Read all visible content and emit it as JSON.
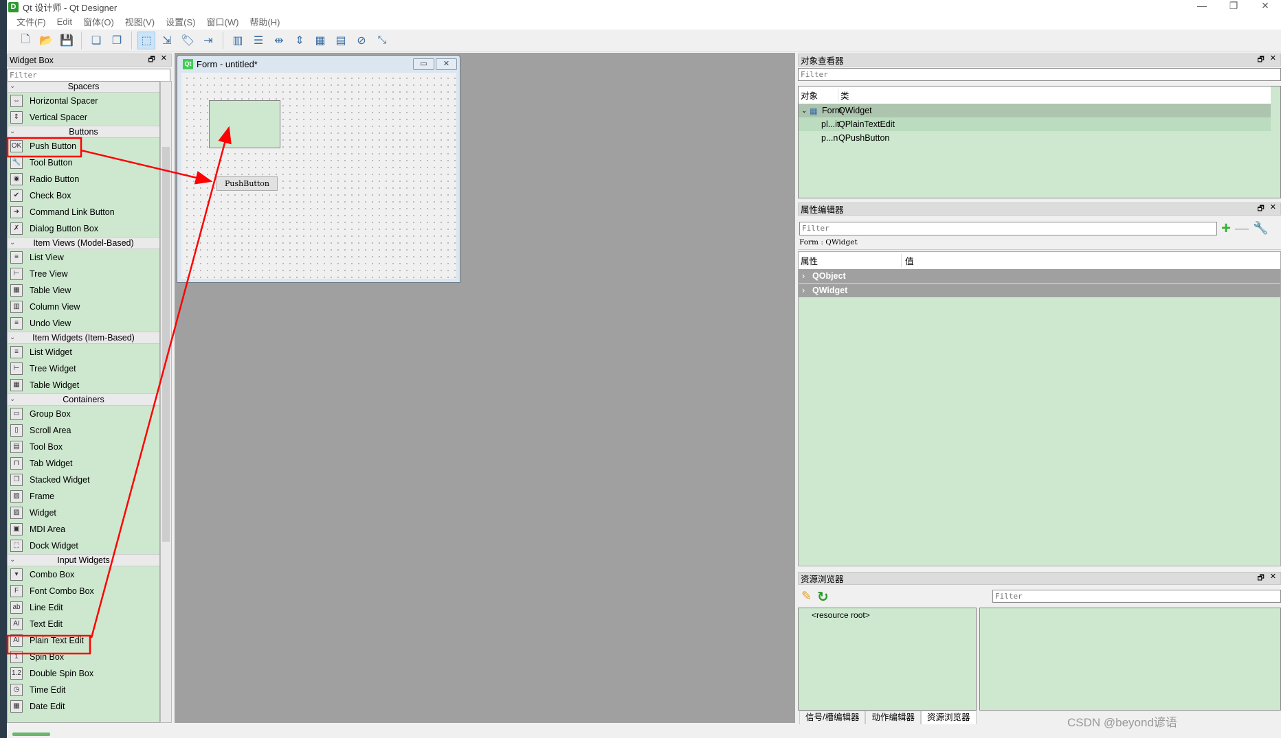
{
  "window": {
    "title": "Qt 设计师 - Qt Designer",
    "app_icon": "D",
    "controls": [
      "—",
      "❐",
      "✕"
    ]
  },
  "menu": [
    "文件(F)",
    "Edit",
    "窗体(O)",
    "视图(V)",
    "设置(S)",
    "窗口(W)",
    "帮助(H)"
  ],
  "toolbar": [
    {
      "icon": "new-file-icon",
      "glyph": "🗋"
    },
    {
      "icon": "open-folder-icon",
      "glyph": "📂"
    },
    {
      "icon": "save-icon",
      "glyph": "💾"
    },
    {
      "sep": true
    },
    {
      "icon": "send-to-back-icon",
      "glyph": "❏"
    },
    {
      "icon": "bring-to-front-icon",
      "glyph": "❐"
    },
    {
      "sep": true
    },
    {
      "icon": "edit-widgets-icon",
      "glyph": "⬚",
      "active": true
    },
    {
      "icon": "edit-signals-slots-icon",
      "glyph": "⇲"
    },
    {
      "icon": "edit-buddies-icon",
      "glyph": "🏷"
    },
    {
      "icon": "edit-tab-order-icon",
      "glyph": "⇥"
    },
    {
      "sep": true
    },
    {
      "icon": "layout-horizontal-icon",
      "glyph": "▥"
    },
    {
      "icon": "layout-vertical-icon",
      "glyph": "☰"
    },
    {
      "icon": "splitter-horizontal-icon",
      "glyph": "⇹"
    },
    {
      "icon": "splitter-vertical-icon",
      "glyph": "⇕"
    },
    {
      "icon": "layout-grid-icon",
      "glyph": "▦"
    },
    {
      "icon": "layout-form-icon",
      "glyph": "▤"
    },
    {
      "icon": "break-layout-icon",
      "glyph": "⊘"
    },
    {
      "icon": "adjust-size-icon",
      "glyph": "⤡"
    }
  ],
  "widget_box": {
    "title": "Widget Box",
    "filter_placeholder": "Filter",
    "categories": [
      {
        "name": "Spacers",
        "items": [
          [
            "Horizontal Spacer",
            "⇔"
          ],
          [
            "Vertical Spacer",
            "⇕"
          ]
        ]
      },
      {
        "name": "Buttons",
        "items": [
          [
            "Push Button",
            "OK"
          ],
          [
            "Tool Button",
            "🔧"
          ],
          [
            "Radio Button",
            "◉"
          ],
          [
            "Check Box",
            "✔"
          ],
          [
            "Command Link Button",
            "➜"
          ],
          [
            "Dialog Button Box",
            "✗"
          ]
        ]
      },
      {
        "name": "Item Views (Model-Based)",
        "items": [
          [
            "List View",
            "≡"
          ],
          [
            "Tree View",
            "⊢"
          ],
          [
            "Table View",
            "▦"
          ],
          [
            "Column View",
            "▥"
          ],
          [
            "Undo View",
            "≡"
          ]
        ]
      },
      {
        "name": "Item Widgets (Item-Based)",
        "items": [
          [
            "List Widget",
            "≡"
          ],
          [
            "Tree Widget",
            "⊢"
          ],
          [
            "Table Widget",
            "▦"
          ]
        ]
      },
      {
        "name": "Containers",
        "items": [
          [
            "Group Box",
            "▭"
          ],
          [
            "Scroll Area",
            "▯"
          ],
          [
            "Tool Box",
            "▤"
          ],
          [
            "Tab Widget",
            "⊓"
          ],
          [
            "Stacked Widget",
            "❐"
          ],
          [
            "Frame",
            "▨"
          ],
          [
            "Widget",
            "▨"
          ],
          [
            "MDI Area",
            "▣"
          ],
          [
            "Dock Widget",
            "⬚"
          ]
        ]
      },
      {
        "name": "Input Widgets",
        "items": [
          [
            "Combo Box",
            "▾"
          ],
          [
            "Font Combo Box",
            "F"
          ],
          [
            "Line Edit",
            "ab"
          ],
          [
            "Text Edit",
            "AI"
          ],
          [
            "Plain Text Edit",
            "AI"
          ],
          [
            "Spin Box",
            "1"
          ],
          [
            "Double Spin Box",
            "1.2"
          ],
          [
            "Time Edit",
            "◷"
          ],
          [
            "Date Edit",
            "▦"
          ]
        ]
      }
    ]
  },
  "form": {
    "title": "Form - untitled*",
    "icon": "Qt",
    "minimize": "▭",
    "close": "✕",
    "push_button_text": "PushButton"
  },
  "object_inspector": {
    "title": "对象查看器",
    "filter_placeholder": "Filter",
    "columns": [
      "对象",
      "类"
    ],
    "rows": [
      {
        "object": "Form",
        "class": "QWidget"
      },
      {
        "object": "pl...it",
        "class": "QPlainTextEdit"
      },
      {
        "object": "p...n",
        "class": "QPushButton"
      }
    ]
  },
  "property_editor": {
    "title": "属性编辑器",
    "filter_placeholder": "Filter",
    "context": "Form : QWidget",
    "columns": [
      "属性",
      "值"
    ],
    "groups": [
      "QObject",
      "QWidget"
    ]
  },
  "resource_browser": {
    "title": "资源浏览器",
    "filter_placeholder": "Filter",
    "root": "<resource root>"
  },
  "bottom_tabs": [
    {
      "label": "信号/槽编辑器"
    },
    {
      "label": "动作编辑器"
    },
    {
      "label": "资源浏览器",
      "active": true
    }
  ],
  "dock_buttons": {
    "float": "🗗",
    "close": "✕"
  },
  "watermark": "CSDN @beyond谚语",
  "annotation_color": "#ff0000"
}
